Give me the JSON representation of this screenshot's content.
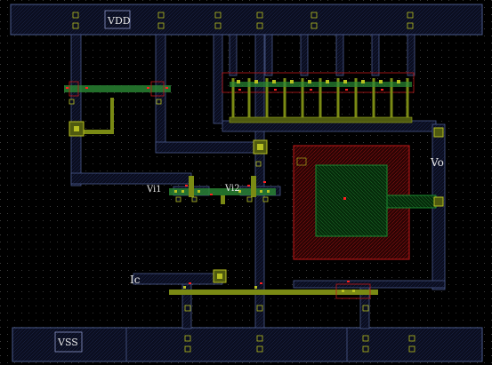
{
  "layout_labels": {
    "vdd": "VDD",
    "vss": "VSS",
    "vo": "Vo",
    "vi1": "Vi1",
    "vi2": "Vi2",
    "ic": "Ic"
  },
  "colors": {
    "background": "#000000",
    "metal1_stroke": "#4a5a8c",
    "metal1_fill": "#0c0f22",
    "poly": "#7a8a14",
    "via": "#b7c020",
    "diffusion": "#1a8a30",
    "nwell": "#c01818",
    "annotation_red": "#ff2020",
    "label_text": "#e8e8e8"
  },
  "grid": {
    "visible": true
  }
}
